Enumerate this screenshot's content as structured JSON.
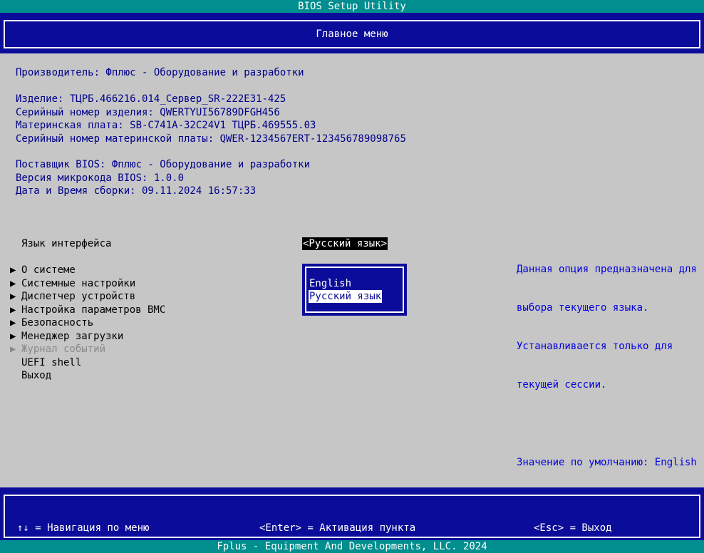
{
  "window": {
    "title": "BIOS Setup Utility"
  },
  "header": {
    "title": "Главное меню"
  },
  "info": {
    "manufacturer": "Производитель: Фплюс - Оборудование и разработки",
    "product": "Изделие: ТЦРБ.466216.014_Сервер_SR-222E31-425",
    "product_serial": "Серийный номер изделия: QWERTYUI56789DFGH456",
    "motherboard": "Материнская плата: SB-C741A-32C24V1 ТЦРБ.469555.03",
    "motherboard_serial": "Серийный номер материнской платы: QWER-1234567ERT-123456789098765",
    "bios_vendor": "Поставщик BIOS: Фплюс - Оборудование и разработки",
    "microcode_version": "Версия микрокода BIOS: 1.0.0",
    "build_datetime": "Дата и Время сборки: 09.11.2024 16:57:33"
  },
  "language": {
    "label": "Язык интерфейса",
    "current_value": "<Русский язык>",
    "options": [
      {
        "label": "English",
        "selected": false
      },
      {
        "label": "Русский язык",
        "selected": true
      }
    ]
  },
  "menu": {
    "submenu_arrow": "▶",
    "items": [
      {
        "label": "О системе",
        "has_submenu": true,
        "disabled": false
      },
      {
        "label": "Системные настройки",
        "has_submenu": true,
        "disabled": false
      },
      {
        "label": "Диспетчер устройств",
        "has_submenu": true,
        "disabled": false
      },
      {
        "label": "Настройка параметров BMC",
        "has_submenu": true,
        "disabled": false
      },
      {
        "label": "Безопасность",
        "has_submenu": true,
        "disabled": false
      },
      {
        "label": "Менеджер загрузки",
        "has_submenu": true,
        "disabled": false
      },
      {
        "label": "Журнал событий",
        "has_submenu": true,
        "disabled": true
      },
      {
        "label": "UEFI shell",
        "has_submenu": false,
        "disabled": false
      },
      {
        "label": "Выход",
        "has_submenu": false,
        "disabled": false
      }
    ]
  },
  "help": {
    "lines": [
      "Данная опция предназначена для",
      "выбора текущего языка.",
      "Устанавливается только для",
      "текущей сессии."
    ],
    "default_value": "Значение по умолчанию: English"
  },
  "hints": {
    "navigate": "↑↓ = Навигация по меню",
    "enter": "<Enter> = Активация пункта",
    "esc": "<Esc> = Выход"
  },
  "footer": {
    "text": "Fplus - Equipment And Developments, LLC. 2024"
  },
  "colors": {
    "background": "#c6c6c6",
    "bar_blue": "#0c0c9a",
    "title_teal": "#008e8e",
    "info_text": "#00008a",
    "help_text": "#0000e0",
    "disabled_text": "#8a8a8a"
  }
}
